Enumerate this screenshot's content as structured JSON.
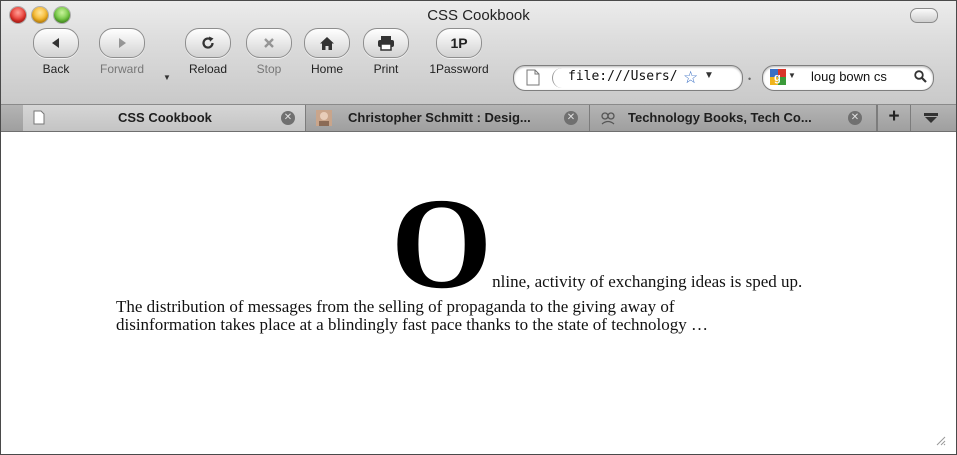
{
  "window": {
    "title": "CSS Cookbook"
  },
  "toolbar": {
    "back_label": "Back",
    "forward_label": "Forward",
    "reload_label": "Reload",
    "stop_label": "Stop",
    "home_label": "Home",
    "print_label": "Print",
    "onepassword_label": "1Password",
    "onepassword_glyph": "1P"
  },
  "address_bar": {
    "url": "file:///Users/ch"
  },
  "search_bar": {
    "query": "loug bown cs"
  },
  "tabs": [
    {
      "title": "CSS Cookbook",
      "active": true,
      "icon": "document-icon"
    },
    {
      "title": "Christopher Schmitt : Desig...",
      "active": false,
      "icon": "portrait-favicon"
    },
    {
      "title": "Technology Books, Tech Co...",
      "active": false,
      "icon": "oreilly-favicon"
    }
  ],
  "page": {
    "drop_cap": "O",
    "line1_rest": "nline, activity of exchanging ideas is sped up.",
    "line2": "The distribution of messages from the selling of propaganda to the giving away of",
    "line3": "disinformation takes place at a blindingly fast pace thanks to the state of technology …"
  },
  "colors": {
    "close": "#e6322a",
    "minimize": "#f5b21f",
    "zoom": "#6bc43a",
    "bookmark_star": "#3a6fc4"
  }
}
